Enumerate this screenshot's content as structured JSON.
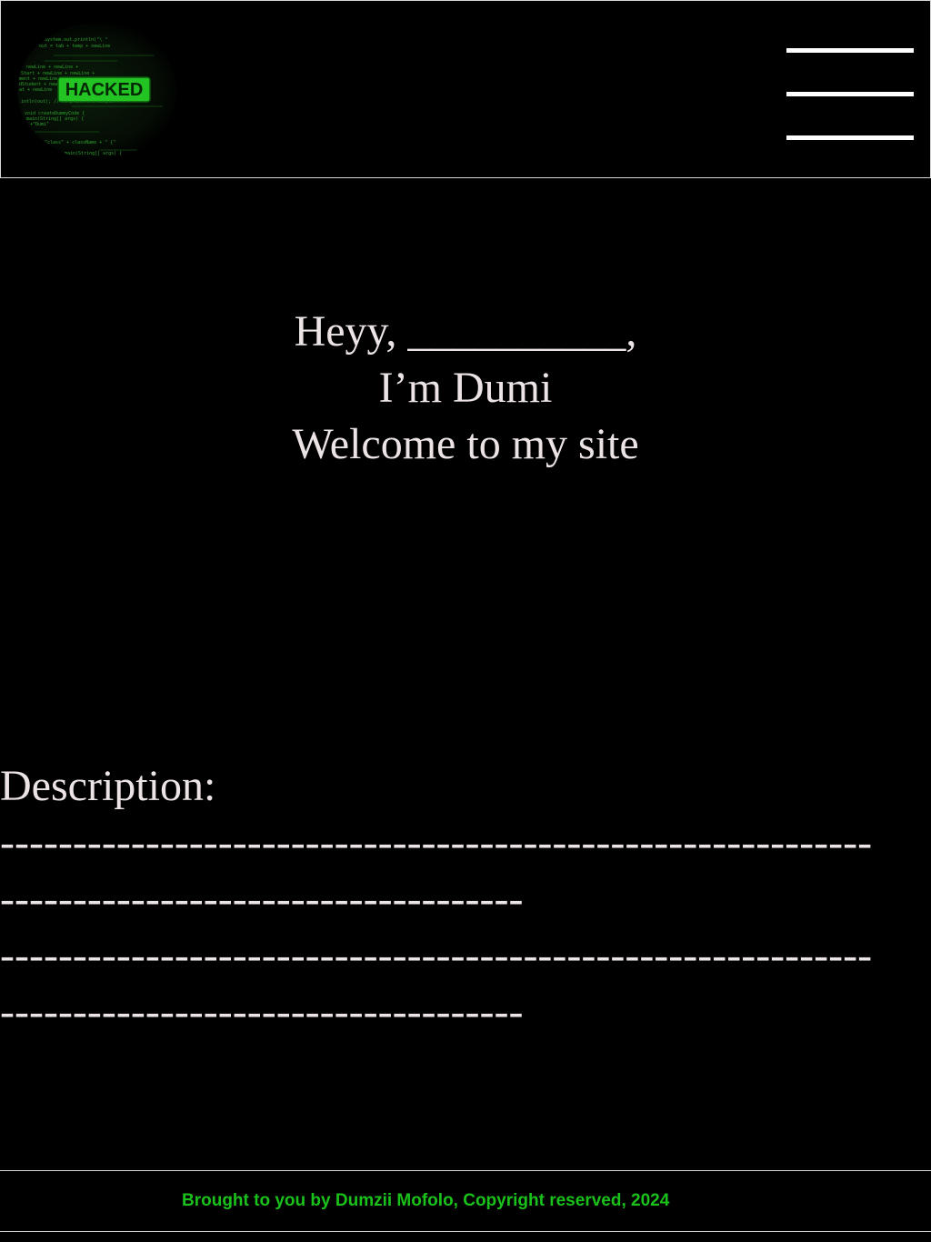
{
  "header": {
    "logo": {
      "badge_text": "HACKED",
      "icon": "hacked-code-logo",
      "code_lines": [
        "System.out.println(\"\\ \"",
        "out = tab + temp + newLine",
        "newLine + newLine +",
        "Start + newLine + newLine +",
        "ment + newLine",
        "dStudent + newLine",
        "at + newLine",
        "intln(out); // To print the output",
        "void createDummyCode {",
        "main(String[] args) {",
        "+\"Dumi\"",
        "\"class\" + className + \" {\"",
        "main(String[] args) {"
      ],
      "accent_color": "#22c322"
    },
    "menu_icon": "hamburger-menu-icon"
  },
  "hero": {
    "line1": "Heyy, __________,",
    "line2": "I’m Dumi",
    "line3": "Welcome to my site"
  },
  "description": {
    "label": "Description:",
    "lines": [
      "------------------------------------------------------------",
      "------------------------------------",
      "------------------------------------------------------------",
      "------------------------------------"
    ]
  },
  "footer": {
    "text": "Brought to you by Dumzii Mofolo, Copyright reserved, 2024",
    "color": "#1bc11b"
  }
}
